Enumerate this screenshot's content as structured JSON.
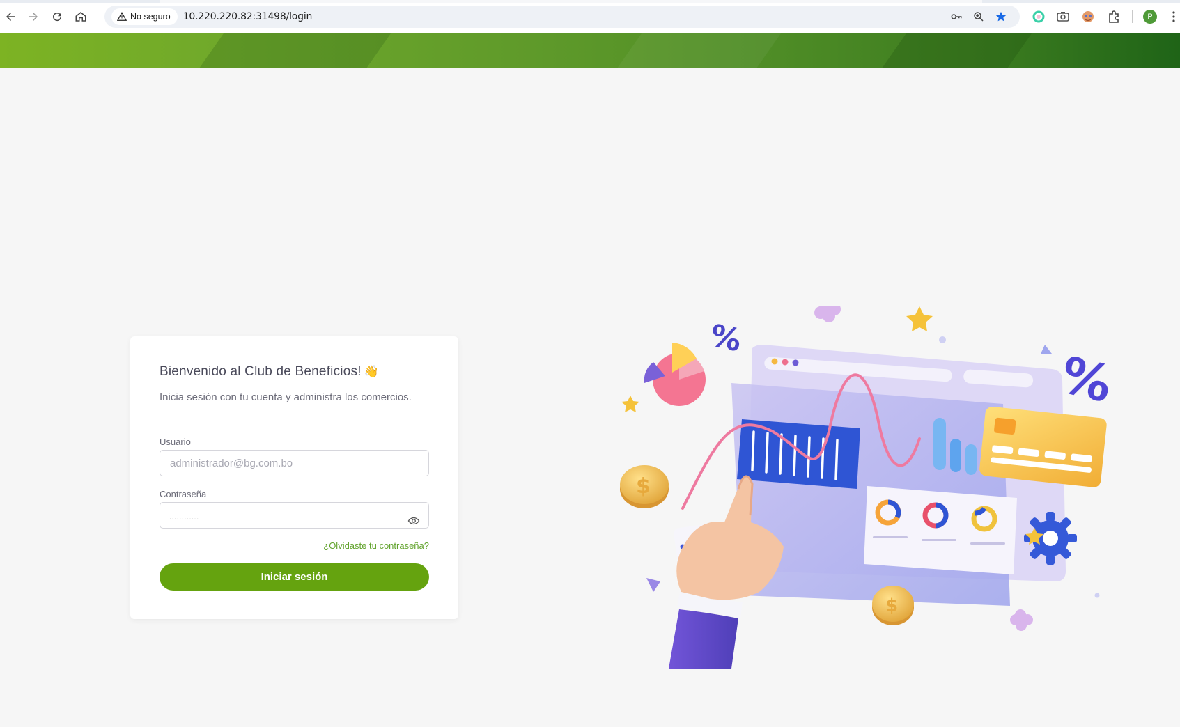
{
  "browser": {
    "security_label": "No seguro",
    "url": "10.220.220.82:31498/login",
    "profile_initial": "P"
  },
  "login": {
    "title": "Bienvenido al Club de Beneficios!",
    "title_emoji": "👋",
    "subtitle": "Inicia sesión con tu cuenta y administra los comercios.",
    "username_label": "Usuario",
    "username_placeholder": "administrador@bg.com.bo",
    "username_value": "",
    "password_label": "Contraseña",
    "password_mask": "............",
    "forgot_link": "¿Olvidaste tu contraseña?",
    "submit_label": "Iniciar sesión"
  },
  "colors": {
    "brand_green": "#65a30f",
    "banner_start": "#7db323",
    "banner_end": "#1f6417",
    "link_green": "#62a32d"
  },
  "illustration": {
    "icons": [
      "percent-icon",
      "pie-chart-icon",
      "dollar-coin-icon",
      "credit-card-icon",
      "gear-icon",
      "checkmark-icon",
      "star-icon",
      "hand-pointer-icon"
    ]
  }
}
